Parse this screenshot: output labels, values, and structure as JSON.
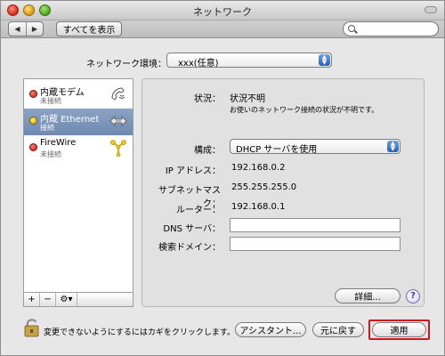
{
  "window": {
    "title": "ネットワーク"
  },
  "toolbar": {
    "back_icon": "triangle-left-icon",
    "forward_icon": "triangle-right-icon",
    "show_all_label": "すべてを表示",
    "search_placeholder": ""
  },
  "location": {
    "label": "ネットワーク環境：",
    "value": "xxx(任意)"
  },
  "services": [
    {
      "name": "内蔵モデム",
      "status": "未接続",
      "status_color": "red",
      "icon": "modem-phone-icon"
    },
    {
      "name": "内蔵 Ethernet",
      "status": "接続",
      "status_color": "yellow",
      "icon": "ethernet-arrows-icon"
    },
    {
      "name": "FireWire",
      "status": "未接続",
      "status_color": "red",
      "icon": "firewire-icon"
    }
  ],
  "list_buttons": {
    "add": "+",
    "remove": "−",
    "gear": "⚙▾"
  },
  "detail": {
    "status_label": "状況：",
    "status_value": "状況不明",
    "status_desc": "お使いのネットワーク接続の状況が不明です。",
    "config_label": "構成：",
    "config_value": "DHCP サーバを使用",
    "ip_label": "IP アドレス：",
    "ip_value": "192.168.0.2",
    "subnet_label": "サブネットマスク：",
    "subnet_value": "255.255.255.0",
    "router_label": "ルーター：",
    "router_value": "192.168.0.1",
    "dns_label": "DNS サーバ：",
    "dns_value": "",
    "search_domain_label": "検索ドメイン：",
    "search_domain_value": "",
    "advanced_label": "詳細...",
    "help_label": "?"
  },
  "footer": {
    "lock_text": "変更できないようにするにはカギをクリックします。",
    "assistant_label": "アシスタント...",
    "revert_label": "元に戻す",
    "apply_label": "適用"
  },
  "colors": {
    "selection": "#7d96bb",
    "status_red": "#d0251a",
    "status_yellow": "#e0b000",
    "highlight_red": "#d0141c"
  }
}
